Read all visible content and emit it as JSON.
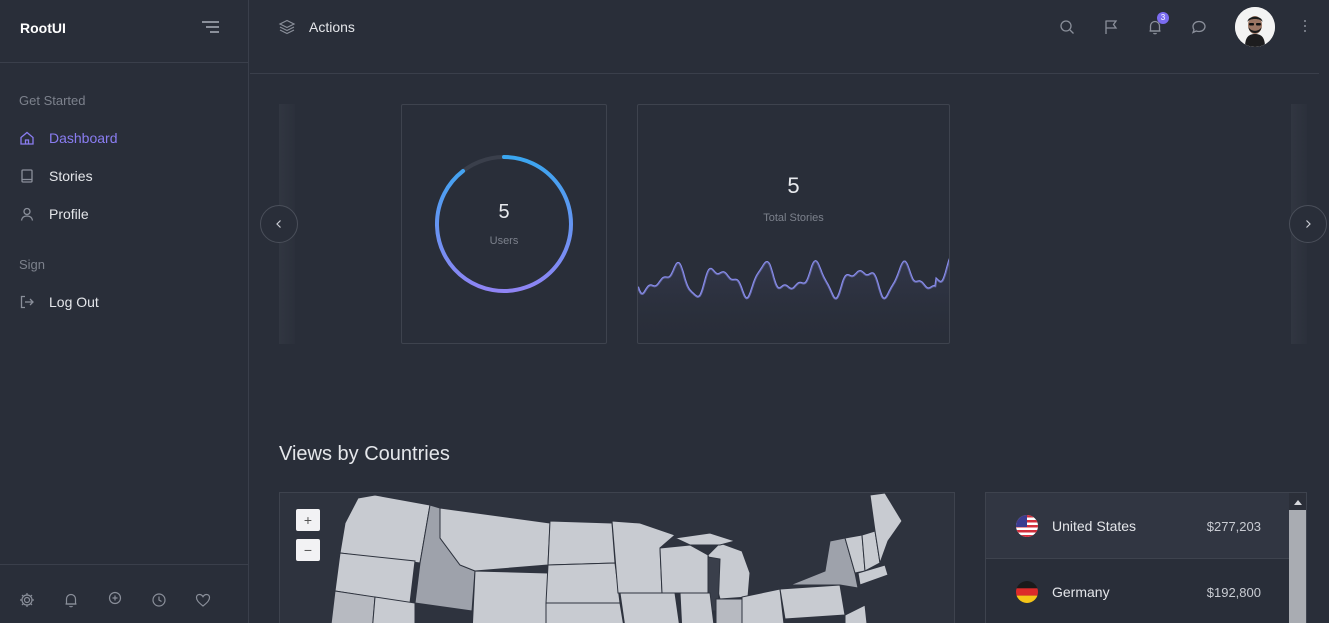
{
  "app": {
    "brand": "RootUI"
  },
  "sidebar": {
    "sections": [
      {
        "label": "Get Started"
      },
      {
        "label": "Sign"
      }
    ],
    "items": [
      {
        "label": "Dashboard",
        "icon": "home-icon",
        "active": true
      },
      {
        "label": "Stories",
        "icon": "book-icon",
        "active": false
      },
      {
        "label": "Profile",
        "icon": "user-icon",
        "active": false
      },
      {
        "label": "Log Out",
        "icon": "logout-icon",
        "active": false
      }
    ],
    "bottom_icons": [
      "settings-icon",
      "bell-icon",
      "plus-circle-icon",
      "clock-icon",
      "heart-icon"
    ]
  },
  "topbar": {
    "title": "Actions",
    "title_icon": "layers-icon",
    "icons": [
      "search-icon",
      "flag-icon",
      "bell-icon",
      "chat-icon"
    ],
    "notification_count": "3"
  },
  "stats": {
    "users": {
      "value": "5",
      "label": "Users"
    },
    "stories": {
      "value": "5",
      "label": "Total Stories"
    }
  },
  "views": {
    "title": "Views by Countries",
    "zoom_in": "+",
    "zoom_out": "−",
    "countries": [
      {
        "name": "United States",
        "value": "$277,203",
        "flag": "us-flag-icon"
      },
      {
        "name": "Germany",
        "value": "$192,800",
        "flag": "de-flag-icon"
      }
    ]
  },
  "colors": {
    "accent": "#8a7df2",
    "background": "#292e39",
    "ring_start": "#3aa6f0",
    "ring_end": "#8f84f4",
    "wave": "#8b8ff0"
  }
}
